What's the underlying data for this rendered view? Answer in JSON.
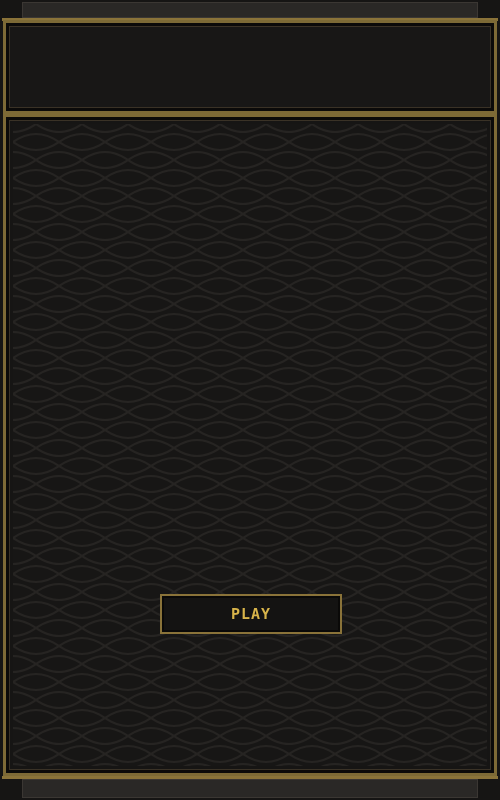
{
  "game": {
    "play_label": "PLAY"
  },
  "theme": {
    "accent": "#8a7339",
    "text_gold": "#d8b44a",
    "background": "#161514"
  }
}
